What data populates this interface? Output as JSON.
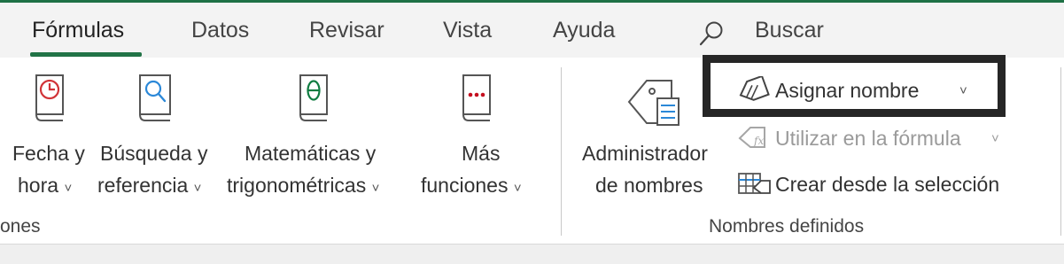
{
  "tabs": [
    {
      "label": "Fórmulas",
      "active": true
    },
    {
      "label": "Datos"
    },
    {
      "label": "Revisar"
    },
    {
      "label": "Vista"
    },
    {
      "label": "Ayuda"
    }
  ],
  "search": {
    "label": "Buscar"
  },
  "function_library": {
    "group_label": "ones",
    "buttons": [
      {
        "line1": "Fecha y",
        "line2": "hora",
        "icon": "clock-book-icon",
        "dropdown": "˅"
      },
      {
        "line1": "Búsqueda y",
        "line2": "referencia",
        "icon": "magnifier-book-icon",
        "dropdown": "˅"
      },
      {
        "line1": "Matemáticas y",
        "line2": "trigonométricas",
        "icon": "theta-book-icon",
        "dropdown": "˅"
      },
      {
        "line1": "Más",
        "line2": "funciones",
        "icon": "more-dots-book-icon",
        "dropdown": "˅"
      }
    ]
  },
  "defined_names": {
    "group_label": "Nombres definidos",
    "name_manager": {
      "line1": "Administrador",
      "line2": "de nombres",
      "icon": "name-manager-icon"
    },
    "define_name": {
      "label": "Asignar nombre",
      "dropdown": "˅",
      "icon": "tag-icon"
    },
    "use_in_formula": {
      "label": "Utilizar en la fórmula",
      "dropdown": "˅",
      "icon": "fx-tag-icon",
      "disabled": true
    },
    "create_from_selection": {
      "label": "Crear desde la selección",
      "icon": "grid-tag-icon"
    }
  },
  "colors": {
    "accent": "#217346",
    "highlight_border": "#262626",
    "clock_red": "#d13438",
    "search_blue": "#2b88d8",
    "theta_green": "#107c41",
    "dots_red": "#c50f1f"
  }
}
